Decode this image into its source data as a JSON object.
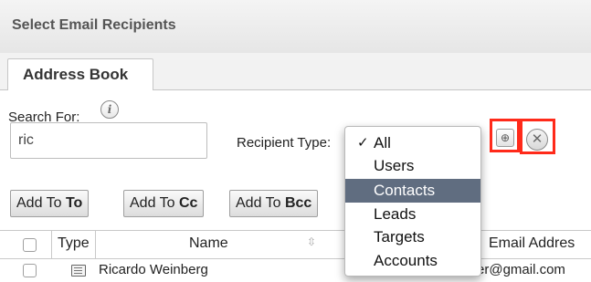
{
  "dialog": {
    "title": "Select Email Recipients"
  },
  "tabs": [
    {
      "label": "Address Book"
    }
  ],
  "search": {
    "label": "Search For:",
    "info_icon": "info-icon",
    "value": "ric"
  },
  "recipient_type": {
    "label": "Recipient Type:",
    "options": [
      "All",
      "Users",
      "Contacts",
      "Leads",
      "Targets",
      "Accounts"
    ],
    "selected": "All",
    "highlighted": "Contacts"
  },
  "icons": {
    "search": "magnifier-plus-icon",
    "clear": "clear-x-icon",
    "highlight_color": "#ff2a1a"
  },
  "buttons": {
    "add_to": {
      "prefix": "Add To ",
      "strong": "To"
    },
    "add_cc": {
      "prefix": "Add To ",
      "strong": "Cc"
    },
    "add_bcc": {
      "prefix": "Add To ",
      "strong": "Bcc"
    }
  },
  "table": {
    "columns": [
      "Type",
      "Name",
      "Email Addres"
    ],
    "rows": [
      {
        "type_icon": "contact-card-icon",
        "name": "Ricardo Weinberg",
        "email_visible": "er@gmail.com"
      }
    ]
  },
  "colors": {
    "selection_bg": "#606d80",
    "header_bg": "#eeeeee"
  }
}
